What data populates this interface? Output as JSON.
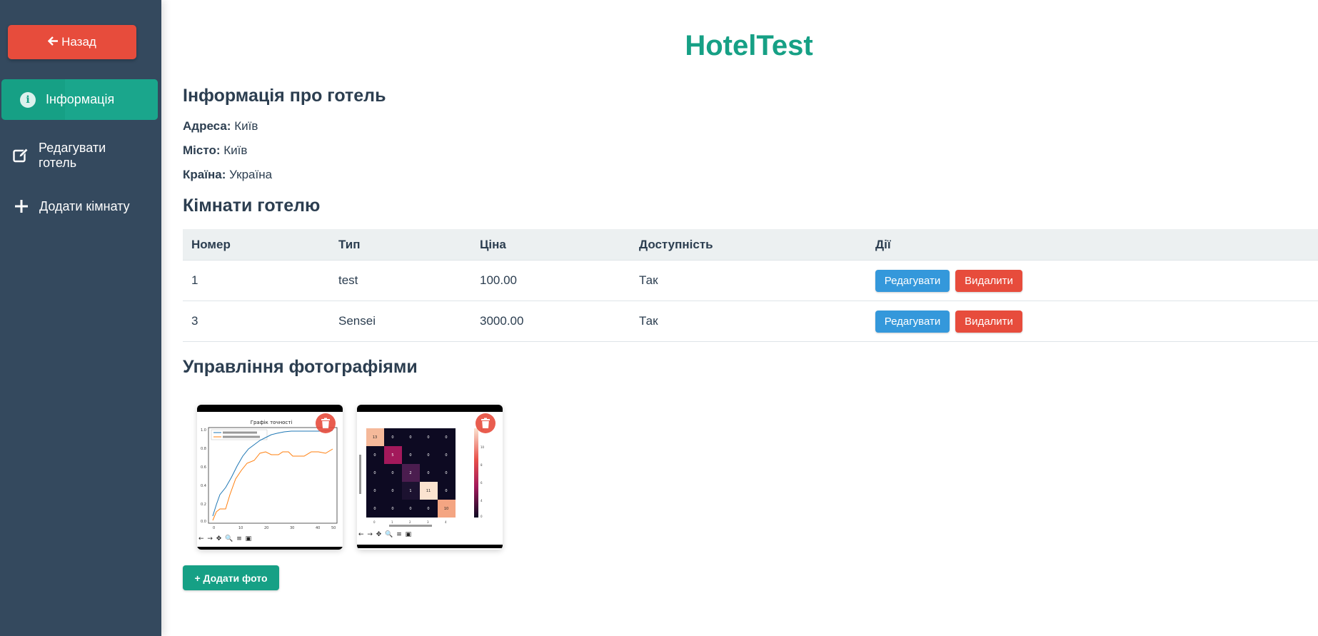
{
  "sidebar": {
    "back_label": "Назад",
    "items": [
      {
        "label": "Інформація",
        "icon": "info-circle-icon",
        "active": true
      },
      {
        "label": "Редагувати готель",
        "icon": "edit-icon"
      },
      {
        "label": "Додати кімнату",
        "icon": "plus-icon"
      }
    ]
  },
  "hotel": {
    "title": "HotelTest",
    "info_heading": "Інформація про готель",
    "address_label": "Адреса:",
    "address": "Київ",
    "city_label": "Місто:",
    "city": "Київ",
    "country_label": "Країна:",
    "country": "Україна"
  },
  "rooms": {
    "heading": "Кімнати готелю",
    "columns": [
      "Номер",
      "Тип",
      "Ціна",
      "Доступність",
      "Дії"
    ],
    "rows": [
      {
        "number": "1",
        "type": "test",
        "price": "100.00",
        "availability": "Так"
      },
      {
        "number": "3",
        "type": "Sensei",
        "price": "3000.00",
        "availability": "Так"
      }
    ],
    "edit_label": "Редагувати",
    "delete_label": "Видалити"
  },
  "photos": {
    "heading": "Управління фотографіями",
    "items": [
      {
        "title": "Графік точності",
        "kind": "line-chart-thumbnail"
      },
      {
        "title": "",
        "kind": "confusion-matrix-thumbnail"
      }
    ],
    "add_label": "+ Додати фото"
  },
  "colors": {
    "sidebar_bg": "#34495e",
    "accent": "#16a085",
    "danger": "#e74c3c",
    "primary": "#3498db",
    "text": "#2c3e50"
  }
}
